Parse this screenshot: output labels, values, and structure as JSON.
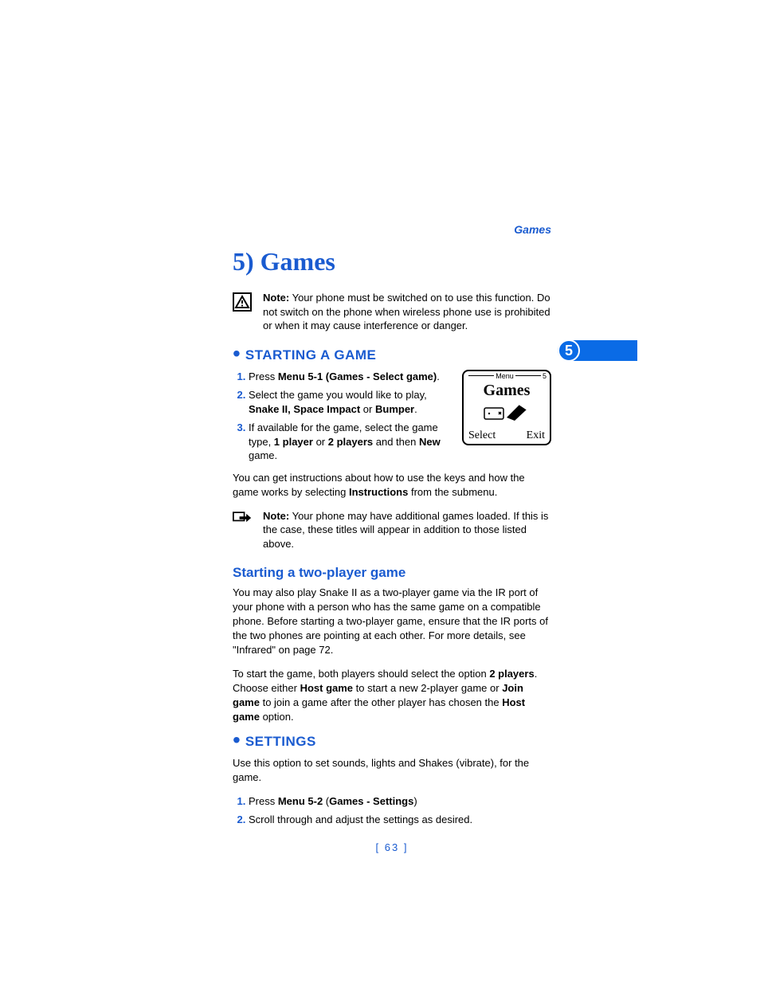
{
  "header": {
    "right": "Games"
  },
  "title": "5) Games",
  "note1": {
    "bold": "Note:",
    "text": " Your phone must be switched on to use this function. Do not switch on the phone when wireless phone use is prohibited or when it may cause interference or danger."
  },
  "tab": "5",
  "sec1": {
    "head": "STARTING A GAME",
    "li1a": "Press ",
    "li1b": "Menu 5-1 (Games - Select game)",
    "li1c": ".",
    "li2a": "Select the game you would like to play, ",
    "li2b": "Snake II, Space Impact",
    "li2c": " or ",
    "li2d": "Bumper",
    "li2e": ".",
    "li3a": "If available for the game, select the game type, ",
    "li3b": "1 player",
    "li3c": " or ",
    "li3d": "2 players",
    "li3e": " and then ",
    "li3f": "New",
    "li3g": " game.",
    "p1a": "You can get instructions about how to use the keys and how the game works by selecting ",
    "p1b": "Instructions",
    "p1c": " from the submenu."
  },
  "phone": {
    "menu": "Menu",
    "idx": "5",
    "title": "Games",
    "left": "Select",
    "right": "Exit"
  },
  "note2": {
    "bold": "Note:",
    "text": " Your phone may have additional games loaded. If this is the case, these titles will appear in addition to those listed above."
  },
  "sub1": {
    "head": "Starting a two-player game",
    "p1": "You may also play Snake II as a two-player game via the IR port of your phone with a person who has the same game on a compatible phone. Before starting a two-player game, ensure that the IR ports of the two phones are pointing at each other. For more details, see \"Infrared\" on page 72.",
    "p2a": "To start the game, both players should select the option ",
    "p2b": "2 players",
    "p2c": ". Choose either ",
    "p2d": "Host game",
    "p2e": " to start a new 2-player game or ",
    "p2f": "Join game",
    "p2g": " to join a game after the other player has chosen the ",
    "p2h": "Host game",
    "p2i": " option."
  },
  "sec2": {
    "head": "SETTINGS",
    "p1": "Use this option to set sounds, lights and Shakes (vibrate), for the game.",
    "li1a": "Press ",
    "li1b": "Menu 5-2",
    "li1c": " (",
    "li1d": "Games - Settings",
    "li1e": ")",
    "li2": "Scroll through and adjust the settings as desired."
  },
  "pagenum": "[ 63 ]"
}
